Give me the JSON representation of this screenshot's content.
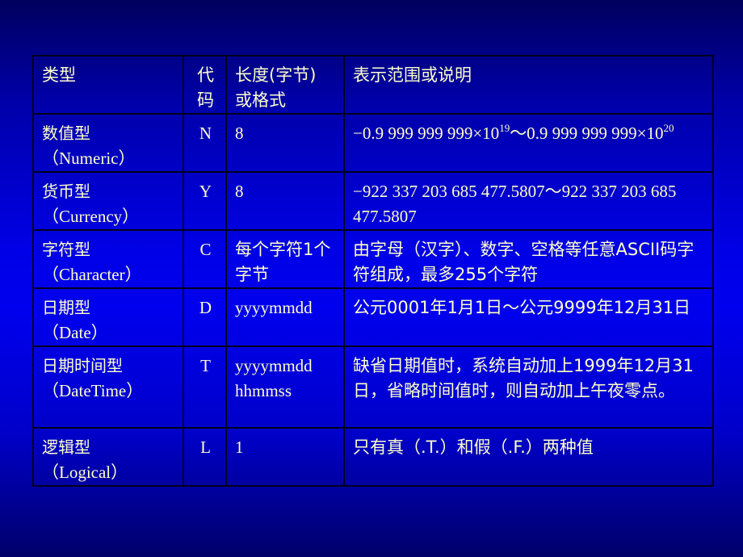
{
  "table": {
    "headers": {
      "type": "类型",
      "code": "代\n码",
      "length": "长度(字节)\n或格式",
      "desc": "表示范围或说明"
    },
    "rows": [
      {
        "type_cn": "数值型",
        "type_en": "（Numeric）",
        "code": "N",
        "length": "8",
        "desc_part1": "−0.9 999 999 999×10",
        "desc_exp1": "19",
        "desc_part2": "～0.9 999 999 999×10",
        "desc_exp2": "20"
      },
      {
        "type_cn": "货币型",
        "type_en": "（Currency）",
        "code": "Y",
        "length": "8",
        "desc": "−922 337 203 685 477.5807～922 337 203 685 477.5807"
      },
      {
        "type_cn": "字符型",
        "type_en": "（Character）",
        "code": "C",
        "length": "每个字符1个字节",
        "desc": "由字母（汉字）、数字、空格等任意ASCII码字符组成，最多255个字符"
      },
      {
        "type_cn": "日期型",
        "type_en": "（Date）",
        "code": "D",
        "length": "yyyymmdd",
        "desc": "公元0001年1月1日～公元9999年12月31日"
      },
      {
        "type_cn": "日期时间型",
        "type_en": "（DateTime）",
        "code": "T",
        "length": "yyyymmdd hhmmss",
        "desc": "缺省日期值时，系统自动加上1999年12月31日，省略时间值时，则自动加上午夜零点。"
      },
      {
        "type_cn": "逻辑型",
        "type_en": "（Logical）",
        "code": "L",
        "length": "1",
        "desc": "只有真（.T.）和假（.F.）两种值"
      }
    ]
  },
  "colors": {
    "text": "#ffffcc",
    "border": "#00001e",
    "background_top": "#00005e",
    "background_mid": "#0000ee"
  }
}
